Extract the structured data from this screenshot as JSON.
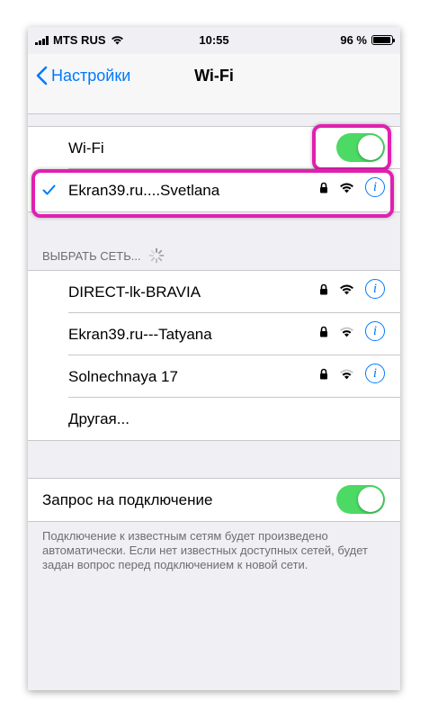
{
  "status_bar": {
    "carrier": "MTS RUS",
    "time": "10:55",
    "battery_percent": "96 %",
    "battery_level": 0.96
  },
  "nav": {
    "back_label": "Настройки",
    "title": "Wi-Fi"
  },
  "wifi_toggle": {
    "label": "Wi-Fi",
    "on": true
  },
  "connected_network": {
    "name": "Ekran39.ru....Svetlana",
    "secured": true,
    "info_icon": "i"
  },
  "choose_network": {
    "header": "ВЫБРАТЬ СЕТЬ...",
    "networks": [
      {
        "name": "DIRECT-lk-BRAVIA",
        "secured": true,
        "signal": "full"
      },
      {
        "name": "Ekran39.ru---Tatyana",
        "secured": true,
        "signal": "medium"
      },
      {
        "name": "Solnechnaya 17",
        "secured": true,
        "signal": "medium"
      }
    ],
    "other_label": "Другая..."
  },
  "ask_to_join": {
    "label": "Запрос на подключение",
    "on": true,
    "description": "Подключение к известным сетям будет произведено автоматически. Если нет известных доступных сетей, будет задан вопрос перед подключением к новой сети."
  },
  "colors": {
    "accent": "#007aff",
    "toggle_on": "#4cd964",
    "highlight": "#e020b0",
    "background": "#efeff4"
  }
}
